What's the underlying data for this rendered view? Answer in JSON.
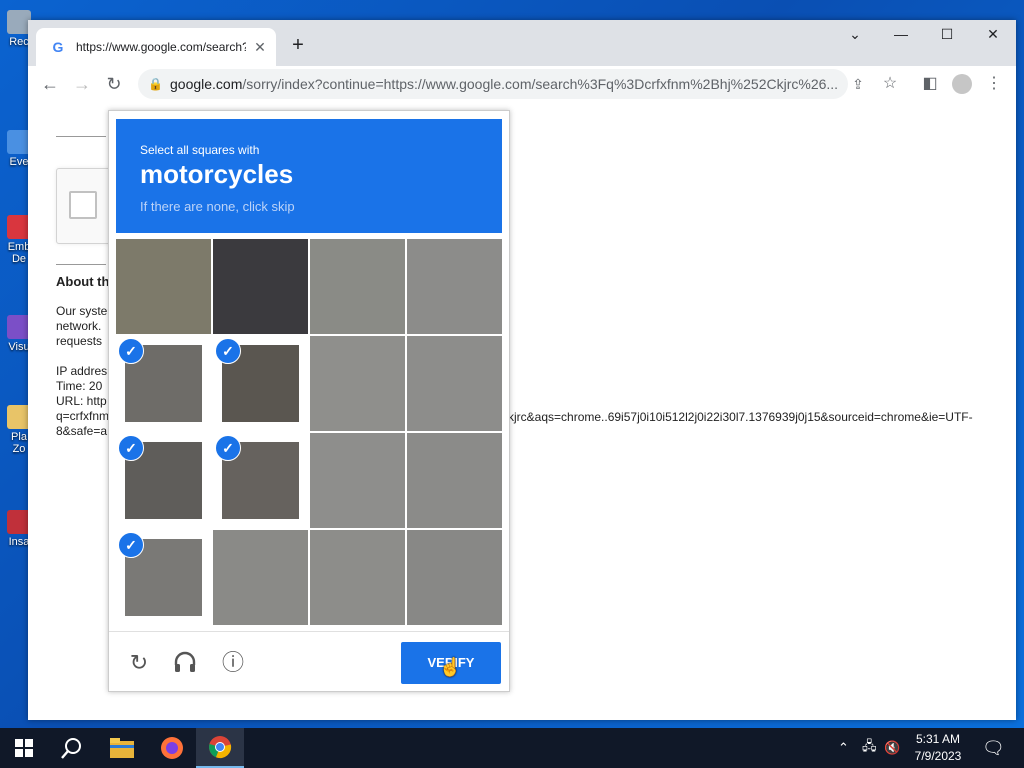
{
  "desktop": {
    "icons": [
      {
        "label": "Rec",
        "color": "#9ab"
      },
      {
        "label": "Eve",
        "color": "#4a90e2"
      },
      {
        "label": "Emb De",
        "color": "#d9363e"
      },
      {
        "label": "Visu",
        "color": "#7b4fc7"
      },
      {
        "label": "Pla Zo",
        "color": "#e8c468"
      },
      {
        "label": "Insa",
        "color": "#c0303a"
      }
    ]
  },
  "browser": {
    "tab": {
      "title": "https://www.google.com/search?",
      "favicon": "G"
    },
    "new_tab": "+",
    "window_controls": {
      "dropdown": "⌄",
      "minimize": "—",
      "maximize": "☐",
      "close": "✕"
    },
    "nav": {
      "back": "←",
      "forward": "→",
      "reload": "↻"
    },
    "address": {
      "domain": "google.com",
      "rest": "/sorry/index?continue=https://www.google.com/search%3Fq%3Dcrfxfnm%2Bhj%252Ckjrc%26..."
    }
  },
  "page": {
    "about_heading": "About th",
    "paragraph_lines": [
      "Our syste",
      "network.",
      "requests"
    ],
    "info_lines": [
      "IP addres",
      "Time: 20",
      "URL: http",
      "q=crfxfnm",
      "8&safe=a"
    ],
    "url_tail": "kjrc&aqs=chrome..69i57j0i10i512l2j0i22i30l7.1376939j0j15&sourceid=chrome&ie=UTF-"
  },
  "captcha": {
    "instruction": "Select all squares with",
    "target": "motorcycles",
    "hint": "If there are none, click skip",
    "selected_tiles": [
      4,
      5,
      8,
      9,
      12
    ],
    "verify_label": "VERIFY",
    "reload_icon": "↻",
    "audio_icon": "🎧",
    "info_icon": "ⓘ"
  },
  "taskbar": {
    "start_icon": "⊞",
    "search_icon": "⚲",
    "apps": [
      "file-explorer",
      "firefox",
      "chrome"
    ],
    "time": "5:31 AM",
    "date": "7/9/2023"
  }
}
